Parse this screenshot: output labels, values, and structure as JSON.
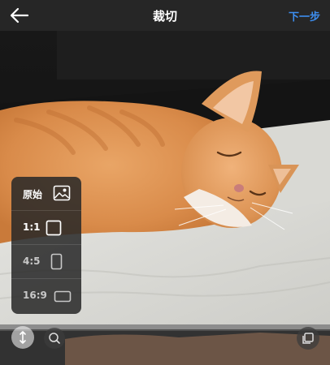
{
  "header": {
    "back_icon": "arrow-left-icon",
    "title": "裁切",
    "next_label": "下一步",
    "next_color": "#3d8ef0"
  },
  "crop_menu": {
    "items": [
      {
        "label": "原始",
        "icon": "image-icon"
      },
      {
        "label": "1:1",
        "icon": "square-icon"
      },
      {
        "label": "4:5",
        "icon": "portrait-rect-icon"
      },
      {
        "label": "16:9",
        "icon": "landscape-rect-icon"
      }
    ]
  },
  "bottom_controls": {
    "expand_icon": "expand-arrows-icon",
    "zoom_icon": "zoom-icon",
    "multi_select_icon": "multi-select-icon"
  }
}
